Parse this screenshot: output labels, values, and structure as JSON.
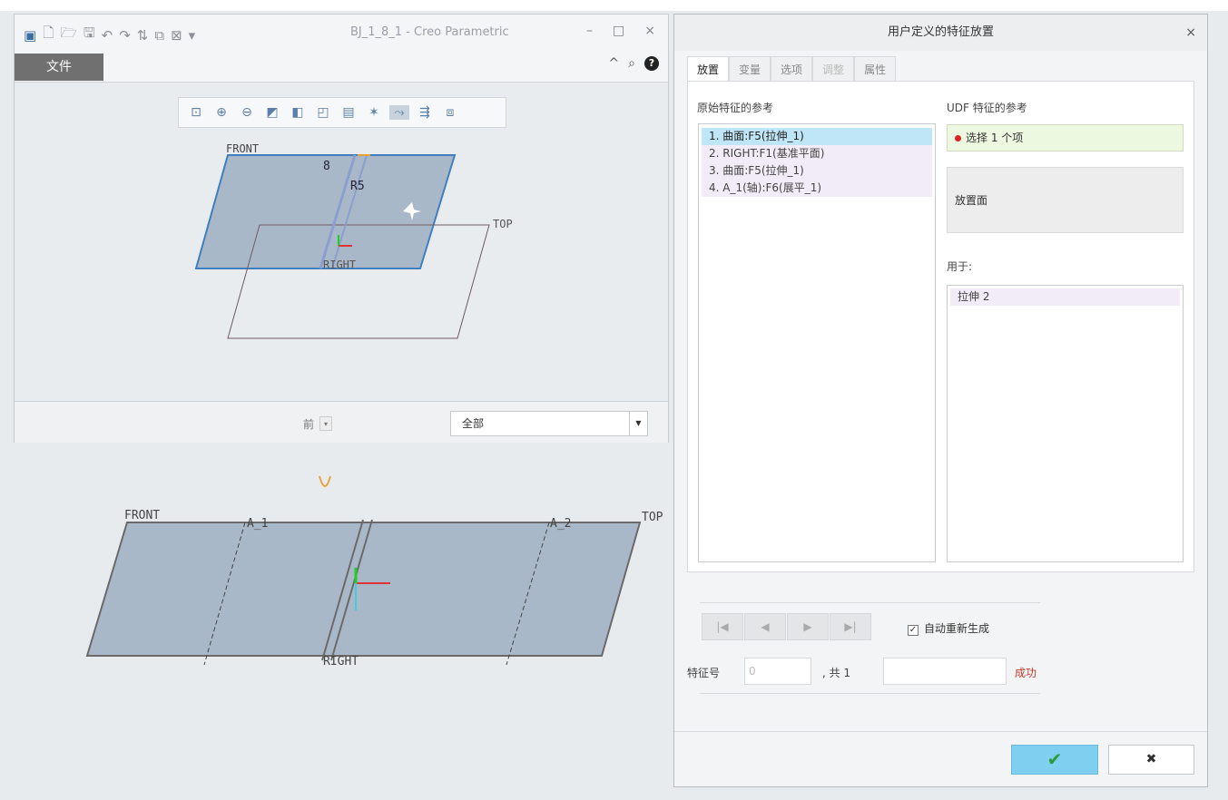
{
  "window": {
    "title": "BJ_1_8_1 - Creo Parametric",
    "file_tab": "文件",
    "minimize": "–",
    "maximize": "□",
    "close": "×",
    "collapse": "^",
    "search": "⌕",
    "help": "?"
  },
  "viewport_labels": {
    "front": "FRONT",
    "top": "TOP",
    "right": "RIGHT",
    "dim": "8",
    "radius": "R5",
    "a1": "A_1",
    "a2": "A_2"
  },
  "filter_bar": {
    "button": "前",
    "select_value": "全部"
  },
  "dialog": {
    "title": "用户定义的特征放置",
    "close": "×",
    "tabs": [
      {
        "label": "放置",
        "state": "active"
      },
      {
        "label": "变量",
        "state": "normal"
      },
      {
        "label": "选项",
        "state": "normal"
      },
      {
        "label": "调整",
        "state": "disabled"
      },
      {
        "label": "属性",
        "state": "normal"
      }
    ],
    "orig_refs_label": "原始特征的参考",
    "orig_refs": [
      "1. 曲面:F5(拉伸_1)",
      "2. RIGHT:F1(基准平面)",
      "3. 曲面:F5(拉伸_1)",
      "4. A_1(轴):F6(展平_1)"
    ],
    "udf_refs_label": "UDF 特征的参考",
    "udf_select": "选择 1 个项",
    "placement_type": "放置面",
    "used_for_label": "用于:",
    "used_for": [
      "拉伸 2"
    ],
    "nav": [
      "|◀",
      "◀",
      "▶",
      "▶|"
    ],
    "auto_regen": {
      "label": "自动重新生成",
      "checked": true
    },
    "feature_no_label": "特征号",
    "feature_no_value": "0",
    "total": ", 共 1",
    "status": "成功",
    "ok": "✔",
    "cancel": "✖"
  },
  "colors": {
    "accent": "#7fcff0",
    "status": "#c0392b",
    "selection": "#bfe6f7"
  }
}
